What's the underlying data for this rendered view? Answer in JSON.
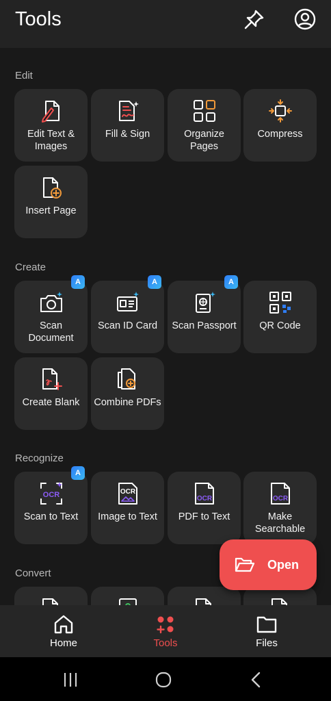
{
  "header": {
    "title": "Tools",
    "pin_icon": "pin-icon",
    "account_icon": "account-icon"
  },
  "sections": [
    {
      "title": "Edit",
      "tools": [
        {
          "label": "Edit Text & Images",
          "icon": "edit-text-icon",
          "ai": false
        },
        {
          "label": "Fill & Sign",
          "icon": "fill-sign-icon",
          "ai": false
        },
        {
          "label": "Organize Pages",
          "icon": "organize-pages-icon",
          "ai": false
        },
        {
          "label": "Compress",
          "icon": "compress-icon",
          "ai": false
        },
        {
          "label": "Insert Page",
          "icon": "insert-page-icon",
          "ai": false
        }
      ]
    },
    {
      "title": "Create",
      "tools": [
        {
          "label": "Scan Document",
          "icon": "scan-document-icon",
          "ai": true
        },
        {
          "label": "Scan ID Card",
          "icon": "scan-id-card-icon",
          "ai": true
        },
        {
          "label": "Scan Passport",
          "icon": "scan-passport-icon",
          "ai": true
        },
        {
          "label": "QR Code",
          "icon": "qr-code-icon",
          "ai": false
        },
        {
          "label": "Create Blank",
          "icon": "create-blank-icon",
          "ai": false
        },
        {
          "label": "Combine PDFs",
          "icon": "combine-pdfs-icon",
          "ai": false
        }
      ]
    },
    {
      "title": "Recognize",
      "tools": [
        {
          "label": "Scan to Text",
          "icon": "scan-to-text-icon",
          "ai": true
        },
        {
          "label": "Image to Text",
          "icon": "image-to-text-icon",
          "ai": false
        },
        {
          "label": "PDF to Text",
          "icon": "pdf-to-text-icon",
          "ai": false
        },
        {
          "label": "Make Searchable",
          "icon": "make-searchable-icon",
          "ai": false
        }
      ]
    },
    {
      "title": "Convert",
      "tools": []
    }
  ],
  "ai_badge": "A",
  "ocr_text": "OCR",
  "fab": {
    "label": "Open",
    "icon": "folder-open-icon"
  },
  "bottom_nav": [
    {
      "label": "Home",
      "icon": "home-icon",
      "active": false
    },
    {
      "label": "Tools",
      "icon": "tools-icon",
      "active": true
    },
    {
      "label": "Files",
      "icon": "folder-icon",
      "active": false
    }
  ],
  "colors": {
    "accent": "#ef4f4f",
    "orange": "#f29a3a",
    "purple": "#8b5cf6",
    "ai_blue": "#2f7ef6",
    "tile": "#2b2b2b",
    "background": "#191919"
  }
}
